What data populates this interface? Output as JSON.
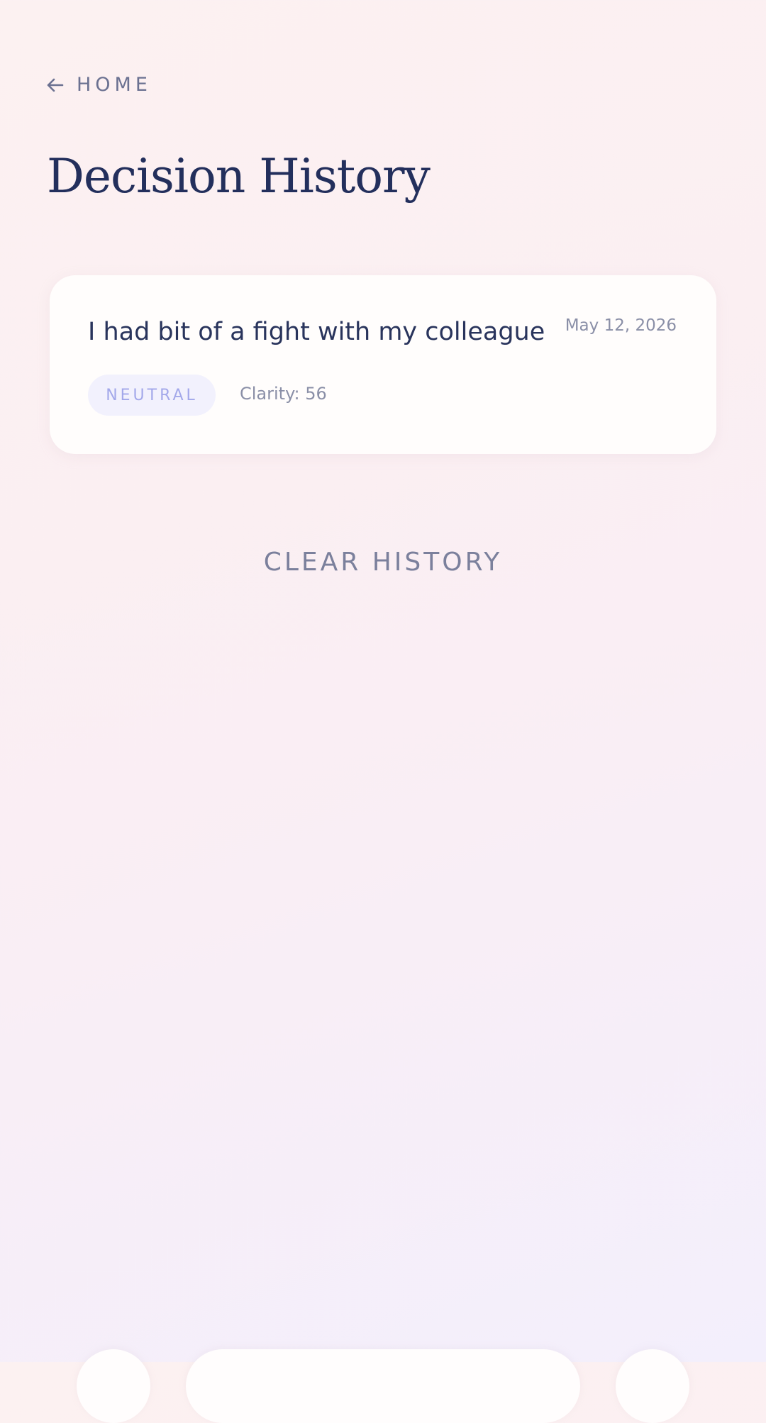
{
  "nav": {
    "back_label": "HOME"
  },
  "page": {
    "title": "Decision History"
  },
  "history": [
    {
      "text": "I had bit of a fight with my colleague",
      "date": "May 12, 2026",
      "mood": "NEUTRAL",
      "clarity": "Clarity: 56"
    }
  ],
  "actions": {
    "clear_history": "CLEAR HISTORY"
  },
  "icons": {
    "back": "arrow-left-icon"
  },
  "colors": {
    "title": "#232f5c",
    "muted": "#8a8fa7",
    "badge_bg": "#f2f1fd",
    "badge_text": "#a3a8ea"
  }
}
